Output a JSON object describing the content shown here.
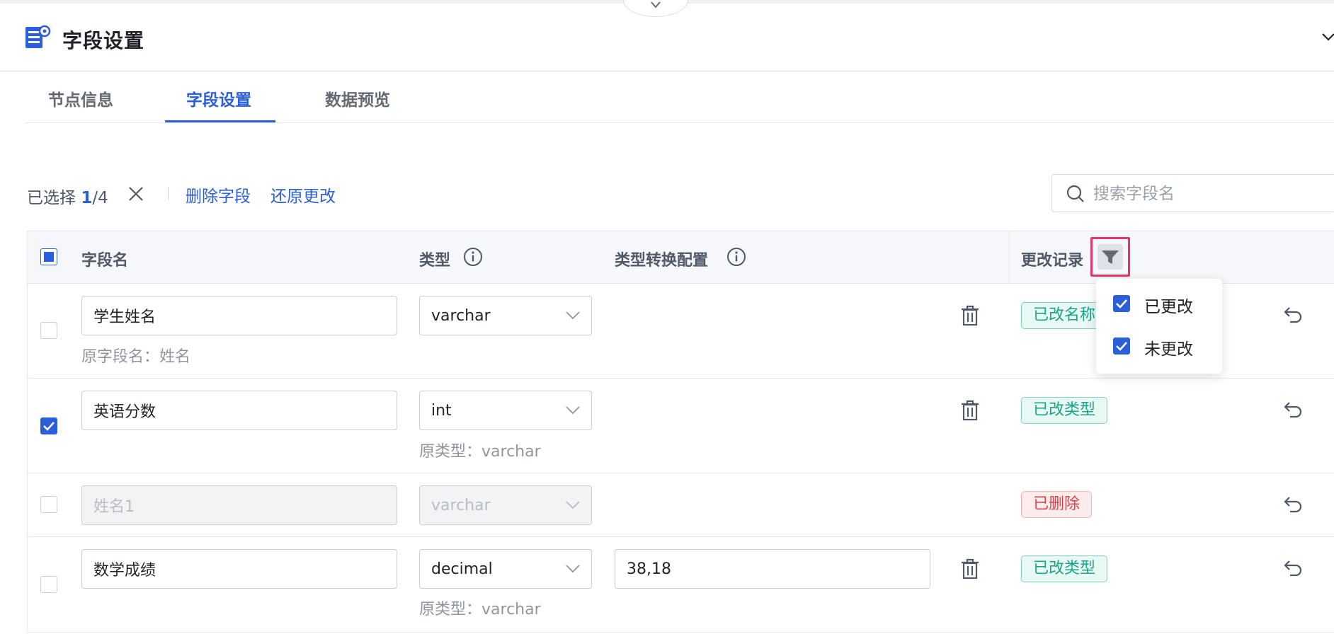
{
  "header": {
    "title": "字段设置"
  },
  "tabs": [
    {
      "label": "节点信息",
      "active": false
    },
    {
      "label": "字段设置",
      "active": true
    },
    {
      "label": "数据预览",
      "active": false
    }
  ],
  "toolbar": {
    "selected_prefix": "已选择 ",
    "selected_count": "1",
    "selected_total": "/4",
    "delete_label": "删除字段",
    "restore_label": "还原更改"
  },
  "search": {
    "placeholder": "搜索字段名"
  },
  "table": {
    "headers": {
      "field_name": "字段名",
      "type": "类型",
      "conversion": "类型转换配置",
      "change_log": "更改记录"
    },
    "rows": [
      {
        "checked": false,
        "name": "学生姓名",
        "original_name": "原字段名：姓名",
        "type": "varchar",
        "original_type": "",
        "conversion": "",
        "tag": "已改名称",
        "tag_color": "green",
        "deleted": false
      },
      {
        "checked": true,
        "name": "英语分数",
        "original_name": "",
        "type": "int",
        "original_type": "原类型：varchar",
        "conversion": "",
        "tag": "已改类型",
        "tag_color": "green",
        "deleted": false
      },
      {
        "checked": false,
        "name": "姓名1",
        "original_name": "",
        "type": "varchar",
        "original_type": "",
        "conversion": "",
        "tag": "已删除",
        "tag_color": "red",
        "deleted": true
      },
      {
        "checked": false,
        "name": "数学成绩",
        "original_name": "",
        "type": "decimal",
        "original_type": "原类型：varchar",
        "conversion": "38,18",
        "tag": "已改类型",
        "tag_color": "green",
        "deleted": false
      }
    ]
  },
  "filter_dropdown": {
    "options": [
      {
        "label": "已更改",
        "checked": true
      },
      {
        "label": "未更改",
        "checked": true
      }
    ]
  },
  "colors": {
    "accent": "#2b5fd9",
    "tag_green": "#17a589",
    "tag_red": "#e0424a",
    "highlight": "#e8336d"
  }
}
